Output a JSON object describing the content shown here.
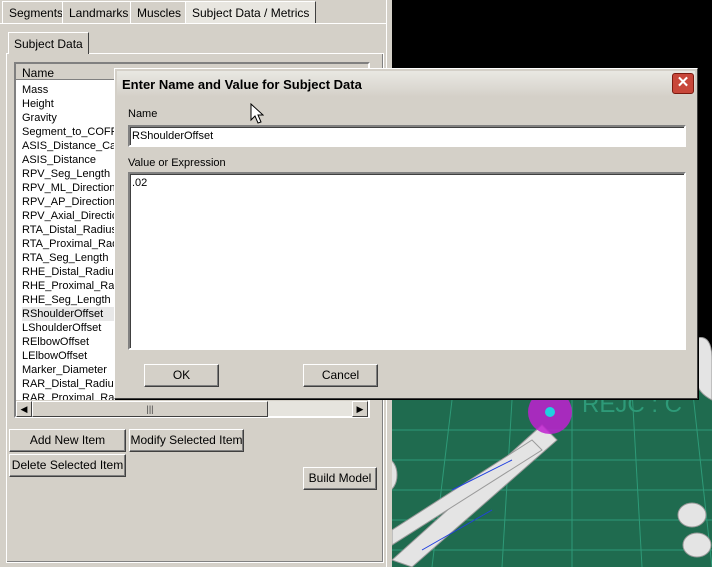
{
  "tabs": [
    "Segments",
    "Landmarks",
    "Muscles",
    "Subject Data / Metrics"
  ],
  "subtab": "Subject Data",
  "list": {
    "header": "Name",
    "items": [
      "Mass",
      "Height",
      "Gravity",
      "Segment_to_COFP",
      "ASIS_Distance_Ca",
      "ASIS_Distance",
      "RPV_Seg_Length",
      "RPV_ML_Direction",
      "RPV_AP_Direction",
      "RPV_Axial_Directio",
      "RTA_Distal_Radius",
      "RTA_Proximal_Rad",
      "RTA_Seg_Length",
      "RHE_Distal_Radius",
      "RHE_Proximal_Rad",
      "RHE_Seg_Length",
      "RShoulderOffset",
      "LShoulderOffset",
      "RElbowOffset",
      "LElbowOffset",
      "Marker_Diameter",
      "RAR_Distal_Radius",
      "RAR_Proximal_Rad"
    ],
    "selected_index": 16
  },
  "buttons": {
    "add": "Add New Item",
    "modify": "Modify Selected Item",
    "delete": "Delete Selected Item",
    "build": "Build Model"
  },
  "dialog": {
    "title": "Enter Name and Value for Subject Data",
    "name_label": "Name",
    "name_value": "RShoulderOffset",
    "value_label": "Value or Expression",
    "value_value": ".02",
    "ok": "OK",
    "cancel": "Cancel"
  },
  "viewport_text": "REJC : C",
  "colors": {
    "floor": "#1f6b4f",
    "grid": "#2e9a78",
    "joint": "#c020d0",
    "marker": "#20d0e0"
  }
}
